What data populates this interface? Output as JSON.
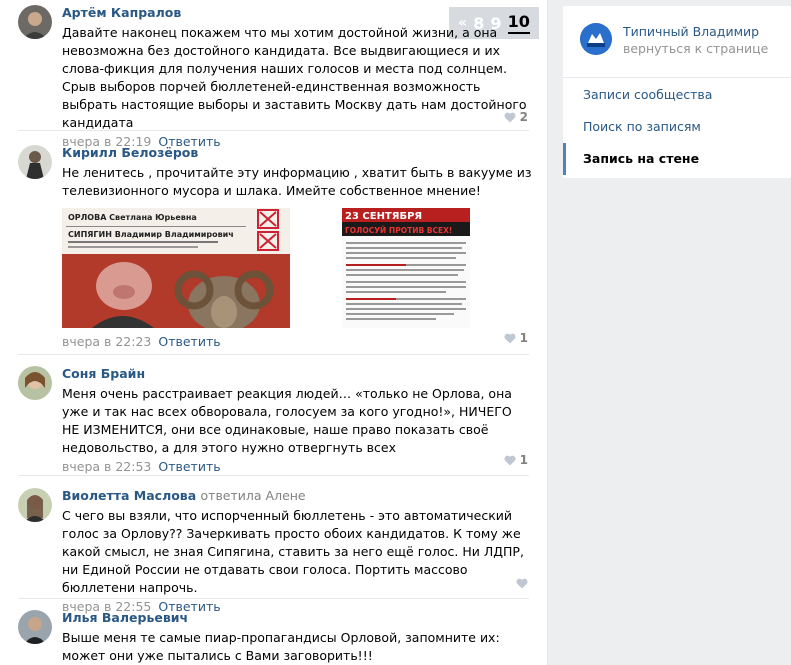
{
  "pagination": {
    "prev": "«",
    "pages": [
      "8",
      "9",
      "10"
    ],
    "active": "10"
  },
  "comments": [
    {
      "author": "Артём Капралов",
      "text": "Давайте наконец покажем что мы хотим достойной жизни, а она невозможна без достойного кандидата. Все выдвигающиеся и их слова-фикция для получения наших голосов и места под солнцем. Срыв выборов порчей бюллетеней-единственная возможность выбрать настоящие выборы и заставить Москву дать нам достойного кандидата",
      "time": "вчера в 22:19",
      "reply": "Ответить",
      "likes": "2"
    },
    {
      "author": "Кирилл Белозёров",
      "text": "Не ленитесь , прочитайте эту информацию , хватит быть в вакууме из телевизионного мусора и шлака. Имейте собственное мнение!",
      "attach1": {
        "name1": "ОРЛОВА Светлана Юрьевна",
        "name2": "СИПЯГИН Владимир Владимирович"
      },
      "attach2": {
        "date": "23 СЕНТЯБРЯ",
        "slogan": "ГОЛОСУЙ ПРОТИВ ВСЕХ!"
      },
      "time": "вчера в 22:23",
      "reply": "Ответить",
      "likes": "1"
    },
    {
      "author": "Соня Брайн",
      "text": "Меня очень расстраивает реакция людей… «только не Орлова, она уже и так нас всех обворовала, голосуем за кого угодно!», НИЧЕГО НЕ ИЗМЕНИТСЯ, они все одинаковые, наше право показать своё недовольство, а для этого нужно отвергнуть всех",
      "time": "вчера в 22:53",
      "reply": "Ответить",
      "likes": "1"
    },
    {
      "author": "Виолетта Маслова",
      "reply_to": "ответила Алене",
      "text": "С чего вы взяли, что испорченный бюллетень - это автоматический голос за Орлову?? Зачеркивать просто обоих кандидатов. К тому же какой смысл, не зная Сипягина, ставить за него ещё голос. Ни ЛДПР, ни Единой России не отдавать свои голоса. Портить массово бюллетени напрочь.",
      "time": "вчера в 22:55",
      "reply": "Ответить",
      "likes": ""
    },
    {
      "author": "Илья Валерьевич",
      "text": "Выше меня те самые пиар-пропагандисы Орловой, запомните их: может они уже пытались с Вами заговорить!!!",
      "time": "",
      "reply": "",
      "likes": ""
    }
  ],
  "sidebar": {
    "group_name": "Типичный Владимир",
    "back_link": "вернуться к странице",
    "menu": [
      "Записи сообщества",
      "Поиск по записям",
      "Запись на стене"
    ]
  },
  "colors": {
    "link": "#2a5885",
    "accent": "#5181b8",
    "bg": "#edeef0"
  }
}
